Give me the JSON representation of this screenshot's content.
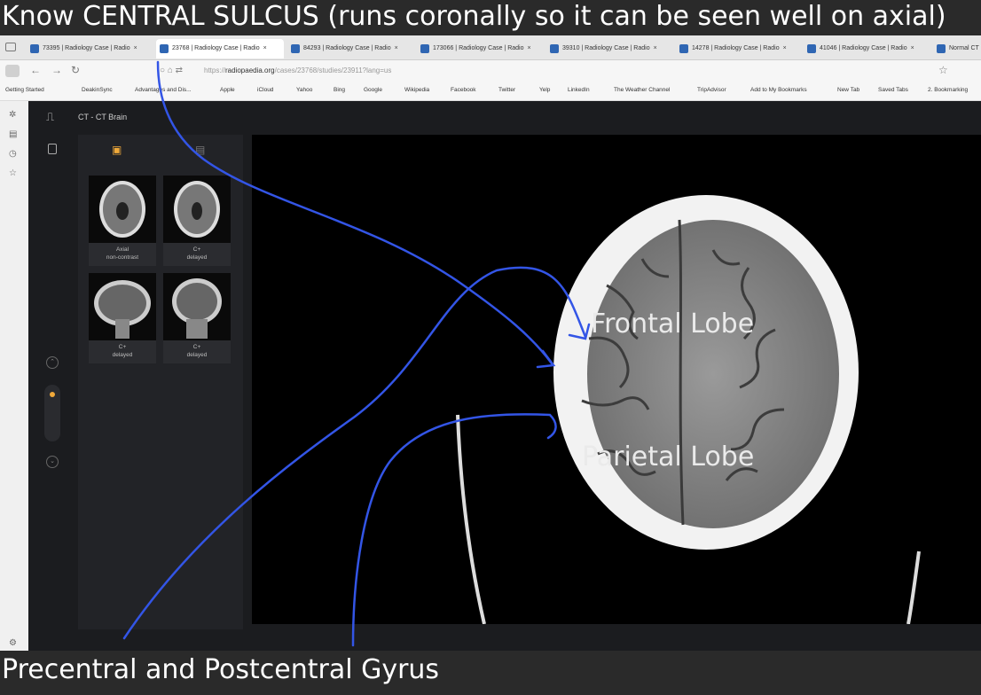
{
  "captions": {
    "top": "Know CENTRAL SULCUS (runs coronally so it can be seen well on axial)",
    "bottom": "Precentral and Postcentral Gyrus"
  },
  "browser": {
    "tabs": [
      {
        "label": "73395 | Radiology Case | Radio",
        "close": "×"
      },
      {
        "label": "23768 | Radiology Case | Radio",
        "close": "×",
        "active": true
      },
      {
        "label": "84293 | Radiology Case | Radio",
        "close": "×"
      },
      {
        "label": "173066 | Radiology Case | Radio",
        "close": "×"
      },
      {
        "label": "39310 | Radiology Case | Radio",
        "close": "×"
      },
      {
        "label": "14278 | Radiology Case | Radio",
        "close": "×"
      },
      {
        "label": "41046 | Radiology Case | Radio",
        "close": "×"
      },
      {
        "label": "Normal CT",
        "close": ""
      }
    ],
    "url_domain": "radiopaedia.org",
    "url_rest": "/cases/23768/studies/23911?lang=us",
    "url_prefix": "https://",
    "bookmarks": [
      "Getting Started",
      "DeakinSync",
      "Advantages and Dis...",
      "Apple",
      "iCloud",
      "Yahoo",
      "Bing",
      "Google",
      "Wikipedia",
      "Facebook",
      "Twitter",
      "Yelp",
      "LinkedIn",
      "The Weather Channel",
      "TripAdvisor",
      "Add to My Bookmarks",
      "New Tab",
      "Saved Tabs",
      "2. Bookmarking"
    ]
  },
  "app": {
    "study_title": "CT - CT Brain",
    "thumbnails": [
      {
        "line1": "Axial",
        "line2": "non-contrast"
      },
      {
        "line1": "C+",
        "line2": "delayed"
      },
      {
        "line1": "C+",
        "line2": "delayed"
      },
      {
        "line1": "C+",
        "line2": "delayed"
      }
    ]
  },
  "annotations": {
    "frontal": "Frontal Lobe",
    "parietal": "Parietal Lobe",
    "stroke_color": "#3355e6"
  },
  "colors": {
    "accent": "#f0a93a",
    "annotation": "#3355e6"
  }
}
